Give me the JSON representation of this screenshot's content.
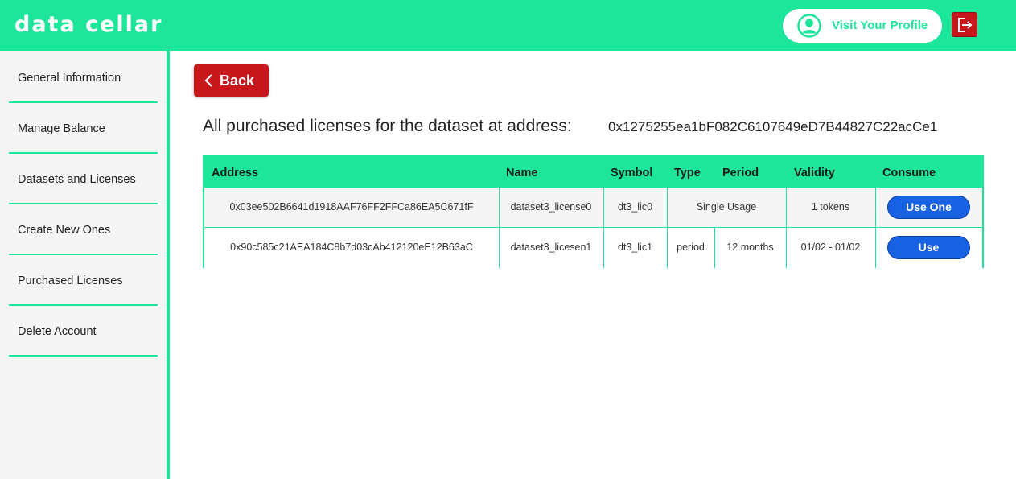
{
  "app": {
    "logo_text": "data cellar"
  },
  "header": {
    "profile_label": "Visit Your Profile"
  },
  "sidebar": {
    "items": [
      {
        "label": "General Information"
      },
      {
        "label": "Manage Balance"
      },
      {
        "label": "Datasets and Licenses"
      },
      {
        "label": "Create New Ones"
      },
      {
        "label": "Purchased Licenses"
      },
      {
        "label": "Delete Account"
      }
    ]
  },
  "main": {
    "back_label": "Back",
    "heading": "All purchased licenses for the dataset at address:",
    "dataset_address": "0x1275255ea1bF082C6107649eD7B44827C22acCe1",
    "table": {
      "headers": [
        "Address",
        "Name",
        "Symbol",
        "Type",
        "Period",
        "Validity",
        "Consume"
      ],
      "rows": [
        {
          "address": "0x03ee502B6641d1918AAF76FF2FFCa86EA5C671fF",
          "name": "dataset3_license0",
          "symbol": "dt3_lic0",
          "type": "Single Usage",
          "period": "",
          "validity": "1 tokens",
          "action": "Use One"
        },
        {
          "address": "0x90c585c21AEA184C8b7d03cAb412120eE12B63aC",
          "name": "dataset3_licesen1",
          "symbol": "dt3_lic1",
          "type": "period",
          "period": "12 months",
          "validity": "01/02 - 01/02",
          "action": "Use"
        }
      ]
    }
  },
  "colors": {
    "accent": "#1de69a",
    "danger": "#c8161d",
    "primary_button": "#1662e3",
    "sidebar_bg": "#f5f5f5"
  },
  "icons": {
    "profile": "user-circle-icon",
    "logout": "logout-icon",
    "back": "chevron-left-icon"
  }
}
